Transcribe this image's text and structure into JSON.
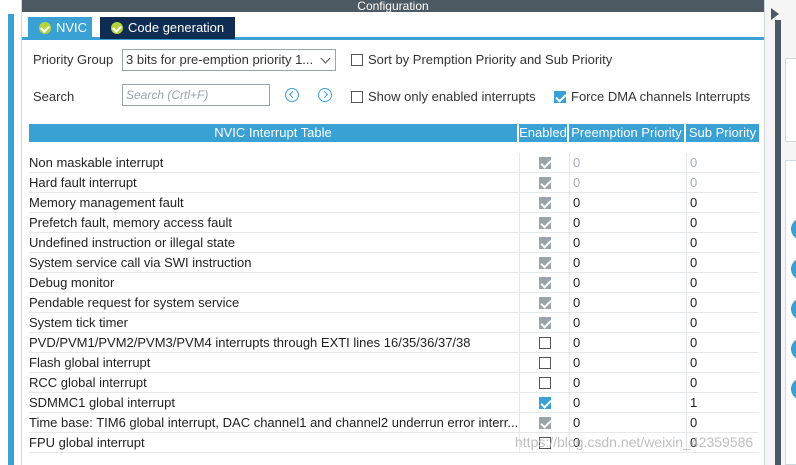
{
  "window": {
    "title": "Configuration"
  },
  "tabs": [
    {
      "label": "NVIC"
    },
    {
      "label": "Code generation"
    }
  ],
  "priority_group": {
    "label": "Priority Group",
    "selected": "3 bits for pre-emption priority 1..."
  },
  "search": {
    "label": "Search",
    "placeholder": "Search (Crtl+F)"
  },
  "options": {
    "sort_by_priority": {
      "label": "Sort by Premption Priority and Sub Priority",
      "checked": false
    },
    "show_only_enabled": {
      "label": "Show only enabled interrupts",
      "checked": false
    },
    "force_dma": {
      "label": "Force DMA channels Interrupts",
      "checked": true
    }
  },
  "table": {
    "headers": {
      "name": "NVIC Interrupt Table",
      "enabled": "Enabled",
      "preemption": "Preemption Priority",
      "sub": "Sub Priority"
    },
    "rows": [
      {
        "name": "Non maskable interrupt",
        "enabled": true,
        "locked": true,
        "preemption": "0",
        "sub": "0",
        "muted": true
      },
      {
        "name": "Hard fault interrupt",
        "enabled": true,
        "locked": true,
        "preemption": "0",
        "sub": "0",
        "muted": true
      },
      {
        "name": "Memory management fault",
        "enabled": true,
        "locked": true,
        "preemption": "0",
        "sub": "0",
        "muted": false
      },
      {
        "name": "Prefetch fault, memory access fault",
        "enabled": true,
        "locked": true,
        "preemption": "0",
        "sub": "0",
        "muted": false
      },
      {
        "name": "Undefined instruction or illegal state",
        "enabled": true,
        "locked": true,
        "preemption": "0",
        "sub": "0",
        "muted": false
      },
      {
        "name": "System service call via SWI instruction",
        "enabled": true,
        "locked": true,
        "preemption": "0",
        "sub": "0",
        "muted": false
      },
      {
        "name": "Debug monitor",
        "enabled": true,
        "locked": true,
        "preemption": "0",
        "sub": "0",
        "muted": false
      },
      {
        "name": "Pendable request for system service",
        "enabled": true,
        "locked": true,
        "preemption": "0",
        "sub": "0",
        "muted": false
      },
      {
        "name": "System tick timer",
        "enabled": true,
        "locked": true,
        "preemption": "0",
        "sub": "0",
        "muted": false
      },
      {
        "name": "PVD/PVM1/PVM2/PVM3/PVM4 interrupts through EXTI lines 16/35/36/37/38",
        "enabled": false,
        "locked": false,
        "preemption": "0",
        "sub": "0",
        "muted": false
      },
      {
        "name": "Flash global interrupt",
        "enabled": false,
        "locked": false,
        "preemption": "0",
        "sub": "0",
        "muted": false
      },
      {
        "name": "RCC global interrupt",
        "enabled": false,
        "locked": false,
        "preemption": "0",
        "sub": "0",
        "muted": false
      },
      {
        "name": "SDMMC1 global interrupt",
        "enabled": true,
        "locked": false,
        "preemption": "0",
        "sub": "1",
        "muted": false
      },
      {
        "name": "Time base: TIM6 global interrupt, DAC channel1 and channel2 underrun error interr...",
        "enabled": true,
        "locked": true,
        "preemption": "0",
        "sub": "0",
        "muted": false
      },
      {
        "name": "FPU global interrupt",
        "enabled": false,
        "locked": false,
        "preemption": "0",
        "sub": "0",
        "muted": false
      }
    ]
  },
  "watermark": "https://blog.csdn.net/weixin_42359586",
  "colors": {
    "accent": "#3aa1d4",
    "tab_dark": "#0f2d52",
    "title_bar": "#4e5a63",
    "tab_check": "#b6d33c"
  }
}
